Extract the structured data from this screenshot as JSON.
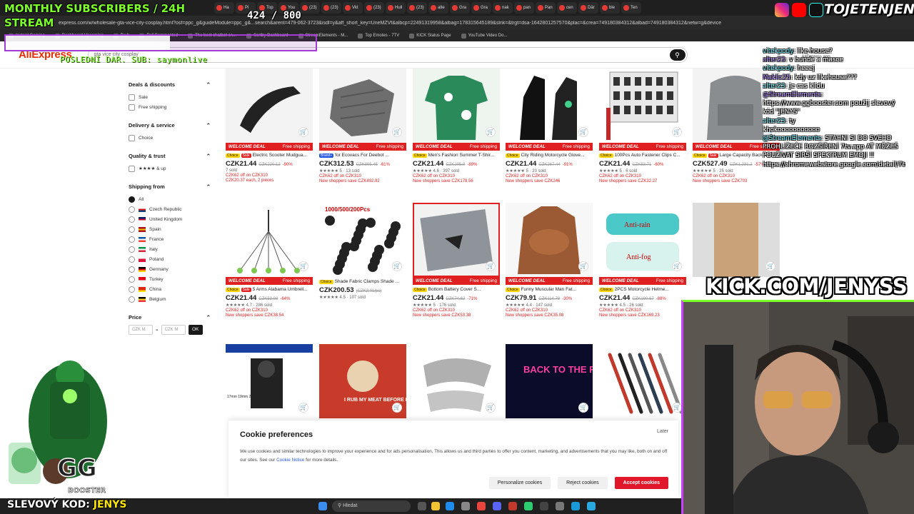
{
  "browser": {
    "url": "express.com/w/wholesale-gta-vice-city-cosplay.html?osf=ppc_g&guideModule=ppc_g&...search&arent=479-062-3723&isdl=y&aff_short_key=UneMZVf&albcp=22491319958&albag=178315645189&slnk=&trgt=dsa-1642801257570&plac=&crea=749180384312&albad=749180384312&netw=g&device",
    "tabs": [
      "Ha",
      "Pi",
      "Top",
      "You",
      "(23)",
      "(23)",
      "Vkt",
      "(23)",
      "Hull",
      "(23)",
      "alte",
      "Gra",
      "Gra",
      "nak",
      "pan",
      "Pan",
      "cen",
      "Där",
      "ble",
      "Ten"
    ],
    "bookmarks": [
      "Instant Gaming",
      "Dashboard Upcoming",
      "Bruh",
      "Ref.Commented",
      "The best chatbot on...",
      "Sortby Dashboard",
      "StreamElements - M...",
      "Top Emotes - 7TV",
      "KICK Status Page",
      "YouTube Video Do..."
    ]
  },
  "header": {
    "logo": "AliExpress",
    "search_value": "gta vice city cosplay",
    "search_icon": "search-icon",
    "download_line1": "Download the",
    "download_line2": "AliExpress app",
    "locale": "CZK",
    "signin": "Sign in / Register",
    "cart_count": "0"
  },
  "filters": {
    "deals": {
      "title": "Deals & discounts",
      "options": [
        "Sale",
        "Free shipping"
      ]
    },
    "delivery": {
      "title": "Delivery & service",
      "options": [
        "Choice"
      ]
    },
    "quality": {
      "title": "Quality & trust",
      "options": [
        "★★★★ & up"
      ]
    },
    "shipping": {
      "title": "Shipping from",
      "options": [
        "All",
        "Czech Republic",
        "United Kingdom",
        "Spain",
        "France",
        "Italy",
        "Poland",
        "Germany",
        "Turkey",
        "China",
        "Belgium"
      ]
    },
    "price": {
      "title": "Price",
      "min_placeholder": "CZK M",
      "max_placeholder": "CZK M",
      "ok": "OK"
    }
  },
  "products": [
    {
      "deal": "WELCOME DEAL",
      "ship": "Free shipping",
      "badges": [
        "Choice",
        "Sale"
      ],
      "title": "Electric Scooter Mudgua...",
      "price": "CZK21.44",
      "old": "CZK220.12",
      "off": "-90%",
      "sold": "7 sold",
      "l1": "CZK62 off on CZK310",
      "l2": "CZK20.37 each, 2 pieces"
    },
    {
      "deal": "WELCOME DEAL",
      "ship": "Free shipping",
      "badges": [
        "Brand+"
      ],
      "title": "for Ecovacs For Deebot ...",
      "price": "CZK312.53",
      "old": "CZK805.45",
      "off": "-61%",
      "sold": "★★★★★ 5 · 13 sold",
      "l1": "CZK62 off on CZK310",
      "l2": "New shoppers save CZK492.92"
    },
    {
      "deal": "WELCOME DEAL",
      "ship": "Free shipping",
      "badges": [
        "Choice"
      ],
      "title": "Men's Fashion Summer T-Shir...",
      "price": "CZK21.44",
      "old": "CZK205.0",
      "off": "-89%",
      "sold": "★★★★★ 4.6 · 397 sold",
      "l1": "CZK62 off on CZK310",
      "l2": "New shoppers save CZK178.56"
    },
    {
      "deal": "WELCOME DEAL",
      "ship": "Free shipping",
      "badges": [
        "Choice"
      ],
      "title": "City Riding Motorcycle Glove...",
      "price": "CZK21.44",
      "old": "CZK267.44",
      "off": "-91%",
      "sold": "★★★★★ 5 · 20 sold",
      "l1": "CZK62 off on CZK310",
      "l2": "New shoppers save CZK246"
    },
    {
      "deal": "WELCOME DEAL",
      "ship": "Free shipping",
      "badges": [
        "Choice"
      ],
      "title": "100Pcs Auto Fastener Clips C...",
      "price": "CZK21.44",
      "old": "CZK53.71",
      "off": "-60%",
      "sold": "★★★★★ 5 · 6 sold",
      "l1": "CZK62 off on CZK310",
      "l2": "New shoppers save CZK32.27"
    },
    {
      "deal": "WELCOME DEAL",
      "ship": "Free shipping",
      "badges": [
        "Choice",
        "Sale"
      ],
      "title": "Large Capacity Backpa...",
      "price": "CZK527.49",
      "old": "CZK1,231.2",
      "off": "-57%",
      "sold": "★★★★★ 5 · 25 sold",
      "l1": "CZK62 off on CZK310",
      "l2": "New shoppers save CZK703"
    },
    {
      "deal": "WELCOME DEAL",
      "ship": "Free shipping",
      "badges": [
        "Choice",
        "Sale"
      ],
      "title": "5 Arms Alabama Umbrell...",
      "price": "CZK21.44",
      "old": "CZK59.98",
      "off": "-64%",
      "sold": "★★★★★ 4.7 · 286 sold",
      "l1": "CZK62 off on CZK310",
      "l2": "New shoppers save CZK38.54"
    },
    {
      "deal": "",
      "ship": "",
      "badges": [
        "Choice"
      ],
      "title": "Shade Fabric Clamps Shade ...",
      "price": "CZK200.53",
      "old": "(CZK2.01/pc)",
      "off": "",
      "sold": "★★★★★ 4.5 · 107 sold",
      "l1": "",
      "l2": ""
    },
    {
      "deal": "WELCOME DEAL",
      "ship": "Free shipping",
      "badges": [
        "Choice"
      ],
      "title": "Bottom Battery Cover S...",
      "price": "CZK21.44",
      "old": "CZK74.62",
      "off": "-71%",
      "sold": "★★★★★ 5 · 176 sold",
      "l1": "CZK62 off on CZK310",
      "l2": "New shoppers save CZK53.38"
    },
    {
      "deal": "WELCOME DEAL",
      "ship": "Free shipping",
      "badges": [
        "Choice"
      ],
      "title": "Funny Muscular Man Fat...",
      "price": "CZK79.91",
      "old": "CZK114.79",
      "off": "-30%",
      "sold": "★★★★★ 4.4 · 147 sold",
      "l1": "CZK62 off on CZK310",
      "l2": "New shoppers save CZK35.08"
    },
    {
      "deal": "WELCOME DEAL",
      "ship": "Free shipping",
      "badges": [
        "Choice"
      ],
      "title": "2PCS Motorcycle Helme...",
      "price": "CZK21.44",
      "old": "CZK190.67",
      "off": "-88%",
      "sold": "★★★★★ 4.5 · 26 sold",
      "l1": "CZK62 off on CZK310",
      "l2": "New shoppers save CZK169.23"
    },
    {
      "deal": "",
      "ship": "",
      "badges": [],
      "title": "",
      "price": "",
      "old": "",
      "off": "",
      "sold": "",
      "l1": "",
      "l2": ""
    },
    {
      "deal": "",
      "ship": "",
      "badges": [],
      "title": "",
      "price": "",
      "old": "",
      "off": "",
      "sold": "",
      "l1": "",
      "l2": ""
    },
    {
      "deal": "",
      "ship": "",
      "badges": [],
      "title": "",
      "price": "",
      "old": "",
      "off": "",
      "sold": "",
      "l1": "",
      "l2": ""
    },
    {
      "deal": "",
      "ship": "",
      "badges": [],
      "title": "",
      "price": "",
      "old": "",
      "off": "",
      "sold": "",
      "l1": "",
      "l2": ""
    },
    {
      "deal": "",
      "ship": "",
      "badges": [],
      "title": "",
      "price": "",
      "old": "",
      "off": "",
      "sold": "",
      "l1": "",
      "l2": ""
    },
    {
      "deal": "",
      "ship": "",
      "badges": [],
      "title": "",
      "price": "",
      "old": "",
      "off": "",
      "sold": "",
      "l1": "",
      "l2": ""
    }
  ],
  "product_thumb_labels": {
    "p8": "1000/500/200Pcs",
    "p13": "17mm 19mm 21mm",
    "p15": "BACK TO THE FUTURE",
    "p11a": "Anti-rain",
    "p11b": "Anti-fog",
    "p14": "I RUB MY MEAT BEFORE I STICK IT IN"
  },
  "cookie": {
    "title": "Cookie preferences",
    "later": "Later",
    "text": "We use cookies and similar technologies to improve your experience and for ads personalisation. This allows us and third parties to offer you content, marketing, and advertisements that you may like, both on and off our sites. See our",
    "link": "Cookie Notice",
    "text_end": "for more details.",
    "personalize": "Personalize cookies",
    "reject": "Reject cookies",
    "accept": "Accept cookies"
  },
  "taskbar": {
    "search": "Hledat"
  },
  "overlay": {
    "sub_banner": "MONTHLY SUBSCRIBERS / 24H STREAM",
    "sub_count": "424 / 800",
    "sub_progress": 0.53,
    "last_sub": "POSLEDNÍ DAR. SUB: saymonlive",
    "handle": "TOJETENJENYS",
    "kick": "KICK.COM/JENYSS",
    "promo_label": "SLEVOVÝ KOD:",
    "promo_code": "JENYS",
    "promo_logo": "GG BOOSTER",
    "colors": {
      "green": "#7dff2a",
      "purple": "#c642ff",
      "ae_red": "#e62e04"
    }
  },
  "chat": [
    {
      "user": "vitekpody",
      "msg": ": like house?"
    },
    {
      "user": "alter23",
      "msg": ": v bunde a masce"
    },
    {
      "user": "vitekpody",
      "msg": ": heeej"
    },
    {
      "user": "Maklic25",
      "msg": ": kdy uz likehouse???"
    },
    {
      "user": "alter23",
      "msg": ": je cas klidu"
    },
    {
      "user": "@StreamElements",
      "msg": ": https://www.ggbooster.com použij slevový kód \"JENYS\""
    },
    {
      "user": "alter23",
      "msg": ": ty"
    },
    {
      "user": "",
      "msg": "khokooooooooooo"
    },
    {
      "user": "@StreamElements",
      "msg": ": STÁHNI SI DO SVÉHO PROHLÍŽEČE ROZŠÍŘENÍ 7tv.app AŤ MŮŽEŠ POUŽÍVAT SIRŠÍ SPEKTRUM EMOJI !! https://chromewebstore.google.com/detail/7tv/ammjkodgmmoknidbanneddgankgfejfh"
    }
  ]
}
